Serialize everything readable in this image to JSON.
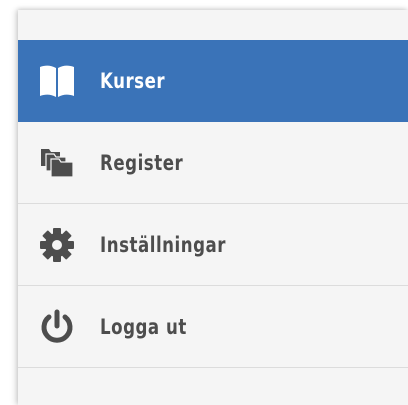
{
  "colors": {
    "active_background": "#3a73b8",
    "active_text": "#ffffff",
    "text": "#4d4d4d",
    "icon": "#4d4d4d",
    "panel_background": "#f5f5f5",
    "divider": "#dcdcdc"
  },
  "menu": {
    "items": [
      {
        "label": "Kurser",
        "icon": "book-open-icon",
        "active": true
      },
      {
        "label": "Register",
        "icon": "stacked-folders-icon",
        "active": false
      },
      {
        "label": "Inställningar",
        "icon": "gear-icon",
        "active": false
      },
      {
        "label": "Logga ut",
        "icon": "power-icon",
        "active": false
      }
    ]
  }
}
